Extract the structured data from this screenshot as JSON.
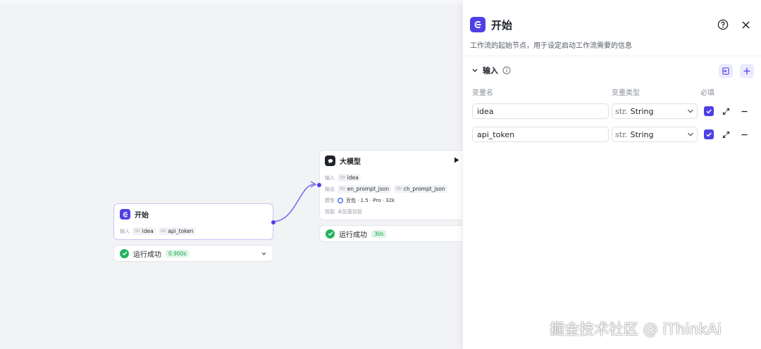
{
  "canvas": {
    "start_node": {
      "title": "开始",
      "input_label": "输入",
      "params": [
        {
          "type": "Str",
          "name": "idea"
        },
        {
          "type": "Str",
          "name": "api_token"
        }
      ],
      "status": {
        "text": "运行成功",
        "time": "0.900s"
      }
    },
    "llm_node": {
      "title": "大模型",
      "input_label": "输入",
      "inputs": [
        {
          "type": "Str",
          "name": "idea"
        }
      ],
      "output_label": "输出",
      "outputs": [
        {
          "type": "Str",
          "name": "en_prompt_json"
        },
        {
          "type": "Str",
          "name": "ch_prompt_json"
        }
      ],
      "model_label": "模型",
      "model_value": "豆包 · 1.5 · Pro · 32k",
      "skill_label": "技能",
      "skill_value": "未配置技能",
      "status": {
        "text": "运行成功",
        "time": "30s"
      }
    }
  },
  "panel": {
    "title": "开始",
    "description": "工作流的起始节点，用于设定启动工作流需要的信息",
    "section_title": "输入",
    "columns": {
      "name": "变量名",
      "type": "变量类型",
      "required": "必填"
    },
    "variables": [
      {
        "name": "idea",
        "type_prefix": "str.",
        "type": "String",
        "required": true
      },
      {
        "name": "api_token",
        "type_prefix": "str.",
        "type": "String",
        "required": true
      }
    ]
  },
  "watermark": "掘金技术社区 @ iThinkAi",
  "colors": {
    "accent": "#4e40e5",
    "success": "#22b35e",
    "canvas_bg": "#f2f3f5"
  }
}
